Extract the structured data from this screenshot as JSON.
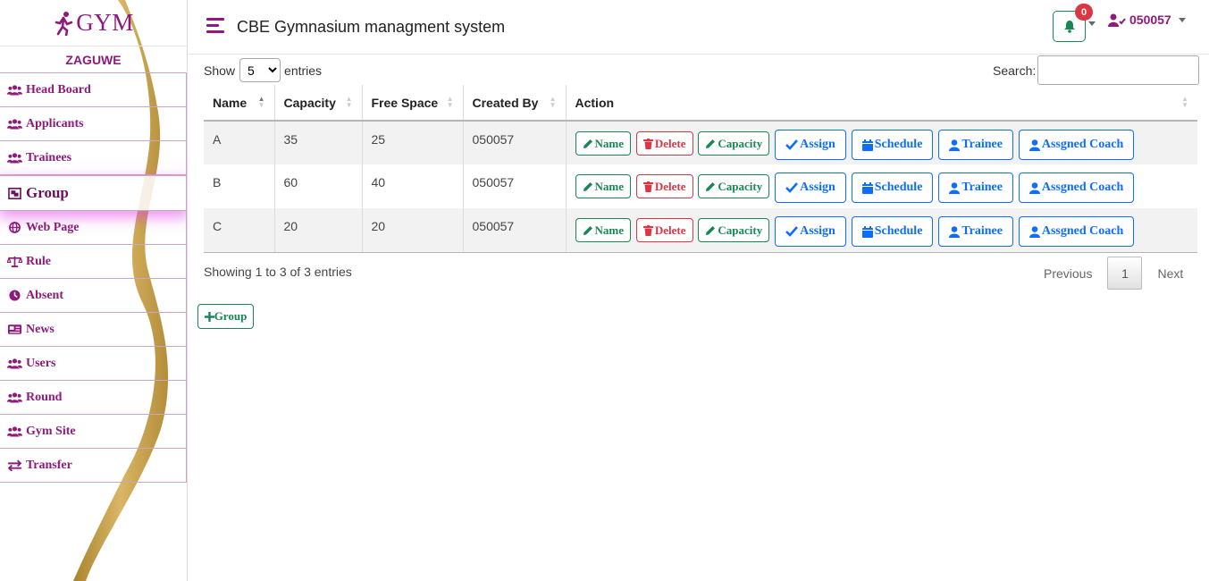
{
  "brand": {
    "logo_text": "GYM",
    "username": "ZAGUWE"
  },
  "sidebar": {
    "items": [
      {
        "label": "Head Board",
        "icon": "users-icon"
      },
      {
        "label": "Applicants",
        "icon": "users-icon"
      },
      {
        "label": "Trainees",
        "icon": "users-icon"
      },
      {
        "label": "Group",
        "icon": "object-group-icon",
        "active": true
      },
      {
        "label": "Web Page",
        "icon": "globe-icon"
      },
      {
        "label": "Rule",
        "icon": "balance-scale-icon"
      },
      {
        "label": "Absent",
        "icon": "clock-icon"
      },
      {
        "label": "News",
        "icon": "newspaper-icon"
      },
      {
        "label": "Users",
        "icon": "users-icon"
      },
      {
        "label": "Round",
        "icon": "users-icon"
      },
      {
        "label": "Gym Site",
        "icon": "users-icon"
      },
      {
        "label": "Transfer",
        "icon": "exchange-icon"
      }
    ]
  },
  "header": {
    "title": "CBE Gymnasium managment system",
    "notification_count": "0",
    "user_id": "050057"
  },
  "datatable": {
    "show_label": "Show",
    "page_length": "5",
    "page_length_options": [
      "5"
    ],
    "entries_label": "entries",
    "search_label": "Search:",
    "search_value": "",
    "columns": [
      "Name",
      "Capacity",
      "Free Space",
      "Created By",
      "Action"
    ],
    "rows": [
      {
        "name": "A",
        "capacity": "35",
        "free_space": "25",
        "created_by": "050057"
      },
      {
        "name": "B",
        "capacity": "60",
        "free_space": "40",
        "created_by": "050057"
      },
      {
        "name": "C",
        "capacity": "20",
        "free_space": "20",
        "created_by": "050057"
      }
    ],
    "actions": {
      "name": "Name",
      "delete": "Delete",
      "capacity": "Capacity",
      "assign": "Assign",
      "schedule": "Schedule",
      "trainee": "Trainee",
      "coach": "Assgned Coach"
    },
    "info": "Showing 1 to 3 of 3 entries",
    "pagination": {
      "previous": "Previous",
      "current": "1",
      "next": "Next"
    }
  },
  "add_group_label": "Group",
  "colors": {
    "brand": "#8e1a7d",
    "success": "#198754",
    "danger": "#dc3545",
    "primary": "#0d6efd",
    "gold": "#c49a3a"
  }
}
